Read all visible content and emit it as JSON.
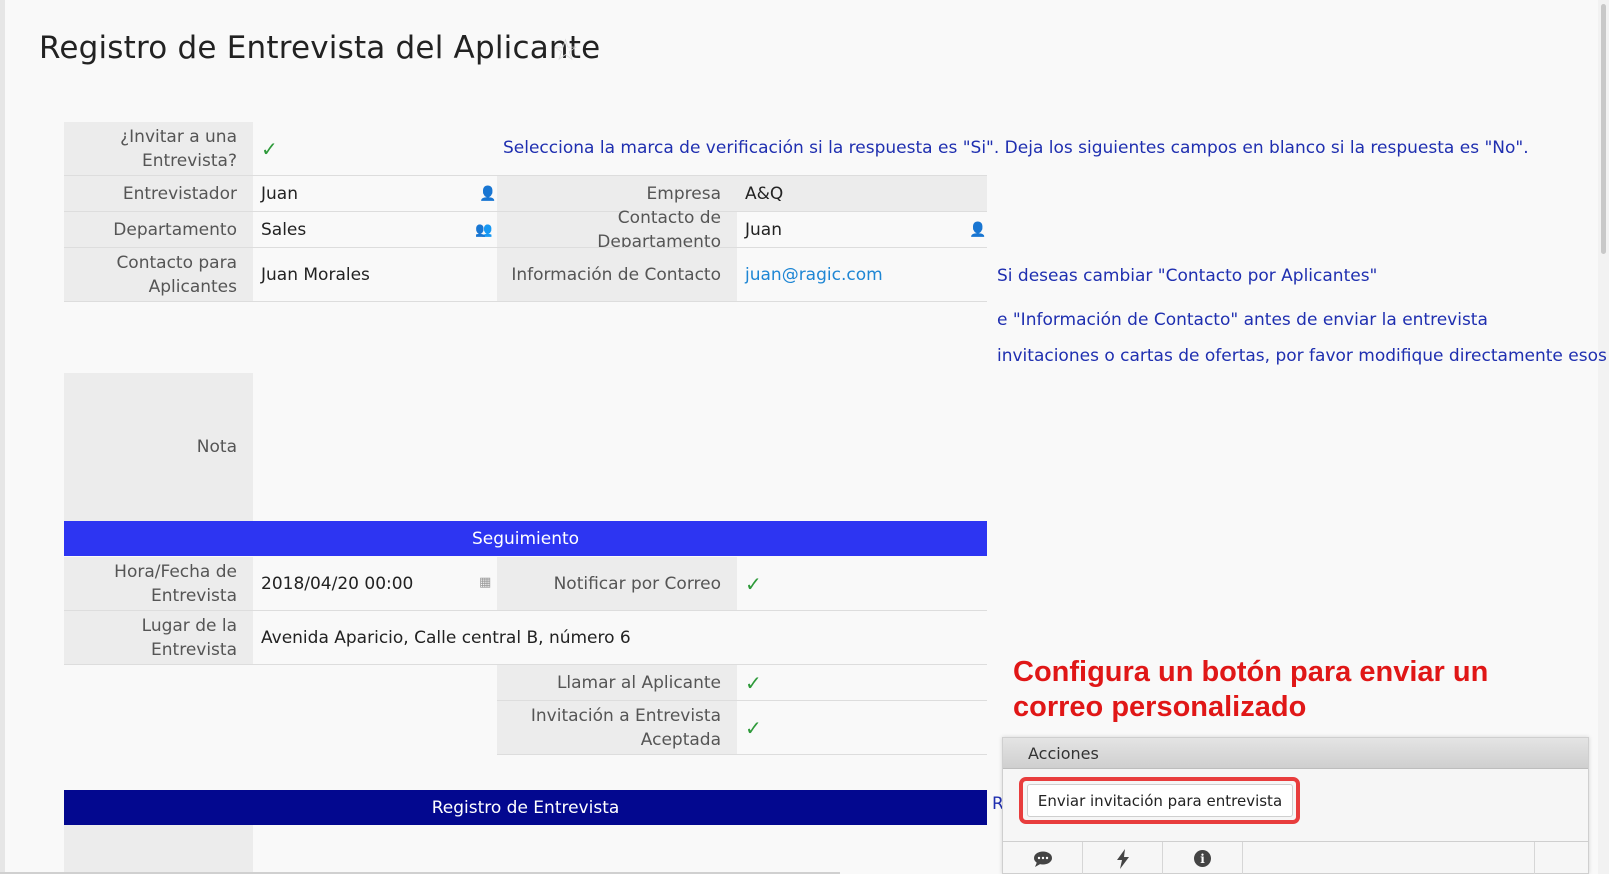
{
  "page": {
    "title": "Registro de Entrevista del Aplicante"
  },
  "colors": {
    "section_primary": "#2d35f2",
    "section_secondary": "#03088f",
    "annotation": "#e01717",
    "hint": "#1f2fb0",
    "check": "#2e9a3a"
  },
  "form": {
    "invite_label": "¿Invitar a una Entrevista?",
    "invite_hint": "Selecciona la marca de verificación si la respuesta es \"Si\". Deja los siguientes campos en blanco si la respuesta es \"No\".",
    "interviewer_label": "Entrevistador",
    "interviewer_value": "Juan",
    "company_label": "Empresa",
    "company_value": "A&Q",
    "department_label": "Departamento",
    "department_value": "Sales",
    "dept_contact_label": "Contacto de Departamento",
    "dept_contact_value": "Juan",
    "applicant_contact_label": "Contacto para Aplicantes",
    "applicant_contact_value": "Juan Morales",
    "contact_info_label": "Información de Contacto",
    "contact_info_value": "juan@ragic.com",
    "contact_hint_1": "Si deseas cambiar \"Contacto por Aplicantes\"",
    "contact_hint_2": "e \"Información de Contacto\" antes de enviar la entrevista",
    "contact_hint_3": "invitaciones o cartas de ofertas, por favor modifique directamente esos valores",
    "note_label": "Nota",
    "note_value": ""
  },
  "followup": {
    "section_title": "Seguimiento",
    "datetime_label": "Hora/Fecha de Entrevista",
    "datetime_value": "2018/04/20 00:00",
    "notify_label": "Notificar por Correo",
    "place_label": "Lugar de la Entrevista",
    "place_value": "Avenida Aparicio, Calle central B, número 6",
    "call_label": "Llamar al Aplicante",
    "accepted_label": "Invitación a Entrevista Aceptada"
  },
  "record": {
    "section_title": "Registro de Entrevista",
    "cut_text": "R"
  },
  "annotation": {
    "line1": "Configura un botón para enviar un",
    "line2": "correo personalizado"
  },
  "actions": {
    "header": "Acciones",
    "button_label": "Enviar invitación para entrevista",
    "toolbar_icons": [
      "comment-icon",
      "lightning-icon",
      "info-icon"
    ]
  }
}
